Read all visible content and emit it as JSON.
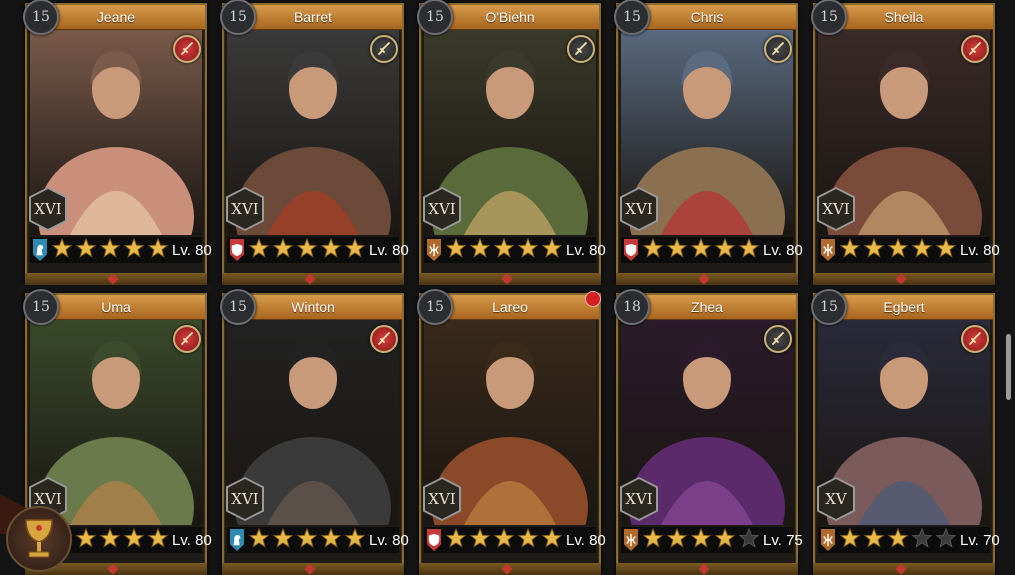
{
  "heroes": [
    {
      "name": "Jeane",
      "level": "15",
      "rank": "XVI",
      "lv": "Lv. 80",
      "stars": 5,
      "role": "cavalry",
      "weapon": "red",
      "palette": [
        "#c98f7a",
        "#e7c8a6",
        "#7a5a4a"
      ]
    },
    {
      "name": "Barret",
      "level": "15",
      "rank": "XVI",
      "lv": "Lv. 80",
      "stars": 5,
      "role": "infantry",
      "weapon": "gray",
      "palette": [
        "#6b4a3a",
        "#a83a22",
        "#3a3a3a"
      ]
    },
    {
      "name": "O'Biehn",
      "level": "15",
      "rank": "XVI",
      "lv": "Lv. 80",
      "stars": 5,
      "role": "archer",
      "weapon": "gray",
      "palette": [
        "#5a6a3a",
        "#c9a86a",
        "#3a3a2a"
      ]
    },
    {
      "name": "Chris",
      "level": "15",
      "rank": "XVI",
      "lv": "Lv. 80",
      "stars": 5,
      "role": "infantry",
      "weapon": "gray",
      "palette": [
        "#8a7050",
        "#b83030",
        "#5a6a80"
      ]
    },
    {
      "name": "Sheila",
      "level": "15",
      "rank": "XVI",
      "lv": "Lv. 80",
      "stars": 5,
      "role": "archer",
      "weapon": "red",
      "palette": [
        "#7a4a3a",
        "#c9a070",
        "#3a2a2a"
      ]
    },
    {
      "name": "Uma",
      "level": "15",
      "rank": "XVI",
      "lv": "Lv. 80",
      "stars": 5,
      "role": "archer",
      "weapon": "red",
      "palette": [
        "#6a7a4a",
        "#b8824a",
        "#3a4a2a"
      ]
    },
    {
      "name": "Winton",
      "level": "15",
      "rank": "XVI",
      "lv": "Lv. 80",
      "stars": 5,
      "role": "cavalry",
      "weapon": "red",
      "palette": [
        "#3a3a3a",
        "#6a5a50",
        "#222222"
      ]
    },
    {
      "name": "Lareo",
      "level": "15",
      "rank": "XVI",
      "lv": "Lv. 80",
      "stars": 5,
      "role": "infantry",
      "weapon": "none",
      "palette": [
        "#8a4a2a",
        "#c08040",
        "#3a2a1a"
      ],
      "alert": true
    },
    {
      "name": "Zhea",
      "level": "18",
      "rank": "XVI",
      "lv": "Lv. 75",
      "stars": 4,
      "role": "archer",
      "weapon": "gray",
      "palette": [
        "#5a2a6a",
        "#8a4a9a",
        "#2a1a2a"
      ]
    },
    {
      "name": "Egbert",
      "level": "15",
      "rank": "XV",
      "lv": "Lv. 70",
      "stars": 3,
      "role": "archer",
      "weapon": "red",
      "palette": [
        "#7a5a5a",
        "#4a5a7a",
        "#2a2a3a"
      ]
    }
  ],
  "colors": {
    "gold": "#e8b84a",
    "star_empty": "#3a3a3a",
    "accent": "#d79a4a"
  },
  "icons": {
    "trophy": "goblet-icon",
    "weapon": "sword-icon",
    "cavalry": "horse-icon",
    "infantry": "shield-icon",
    "archer": "bow-icon"
  }
}
